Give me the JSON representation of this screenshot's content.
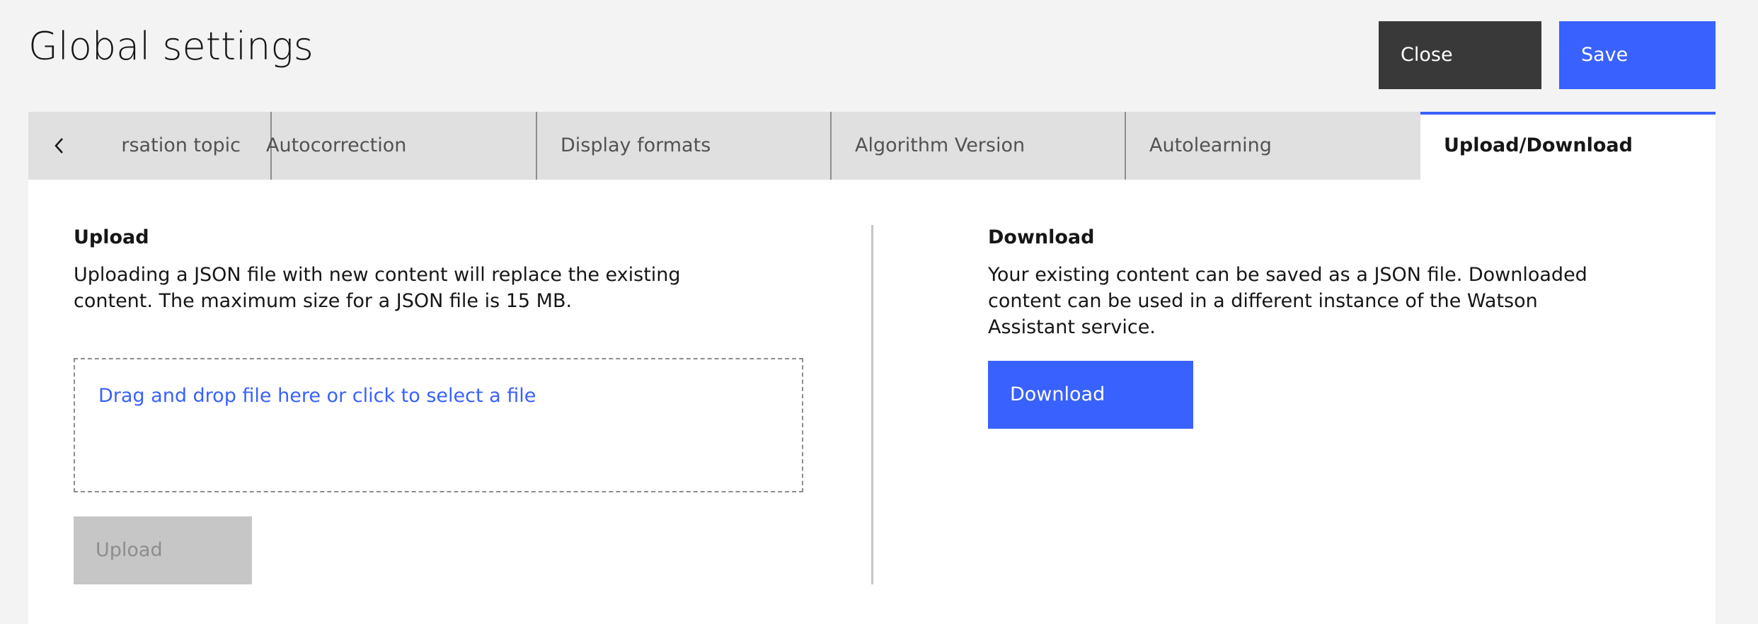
{
  "header": {
    "title": "Global settings",
    "close_label": "Close",
    "save_label": "Save"
  },
  "tabs": {
    "prev_icon": "chevron-left-icon",
    "items": [
      {
        "label": "Conversation topic",
        "visible_label": "rsation topic"
      },
      {
        "label": "Autocorrection"
      },
      {
        "label": "Display formats"
      },
      {
        "label": "Algorithm Version"
      },
      {
        "label": "Autolearning"
      },
      {
        "label": "Upload/Download",
        "active": true
      }
    ]
  },
  "upload": {
    "title": "Upload",
    "description": "Uploading a JSON file with new content will replace the existing content. The maximum size for a JSON file is 15 MB.",
    "dropzone_text": "Drag and drop file here or click to select a file",
    "button_label": "Upload"
  },
  "download": {
    "title": "Download",
    "description": "Your existing content can be saved as a JSON file. Downloaded content can be used in a different instance of the Watson Assistant service.",
    "button_label": "Download"
  },
  "colors": {
    "accent": "#3961fe",
    "dark_button": "#393939",
    "disabled_button": "#c6c6c6",
    "page_background": "#f3f3f3"
  }
}
